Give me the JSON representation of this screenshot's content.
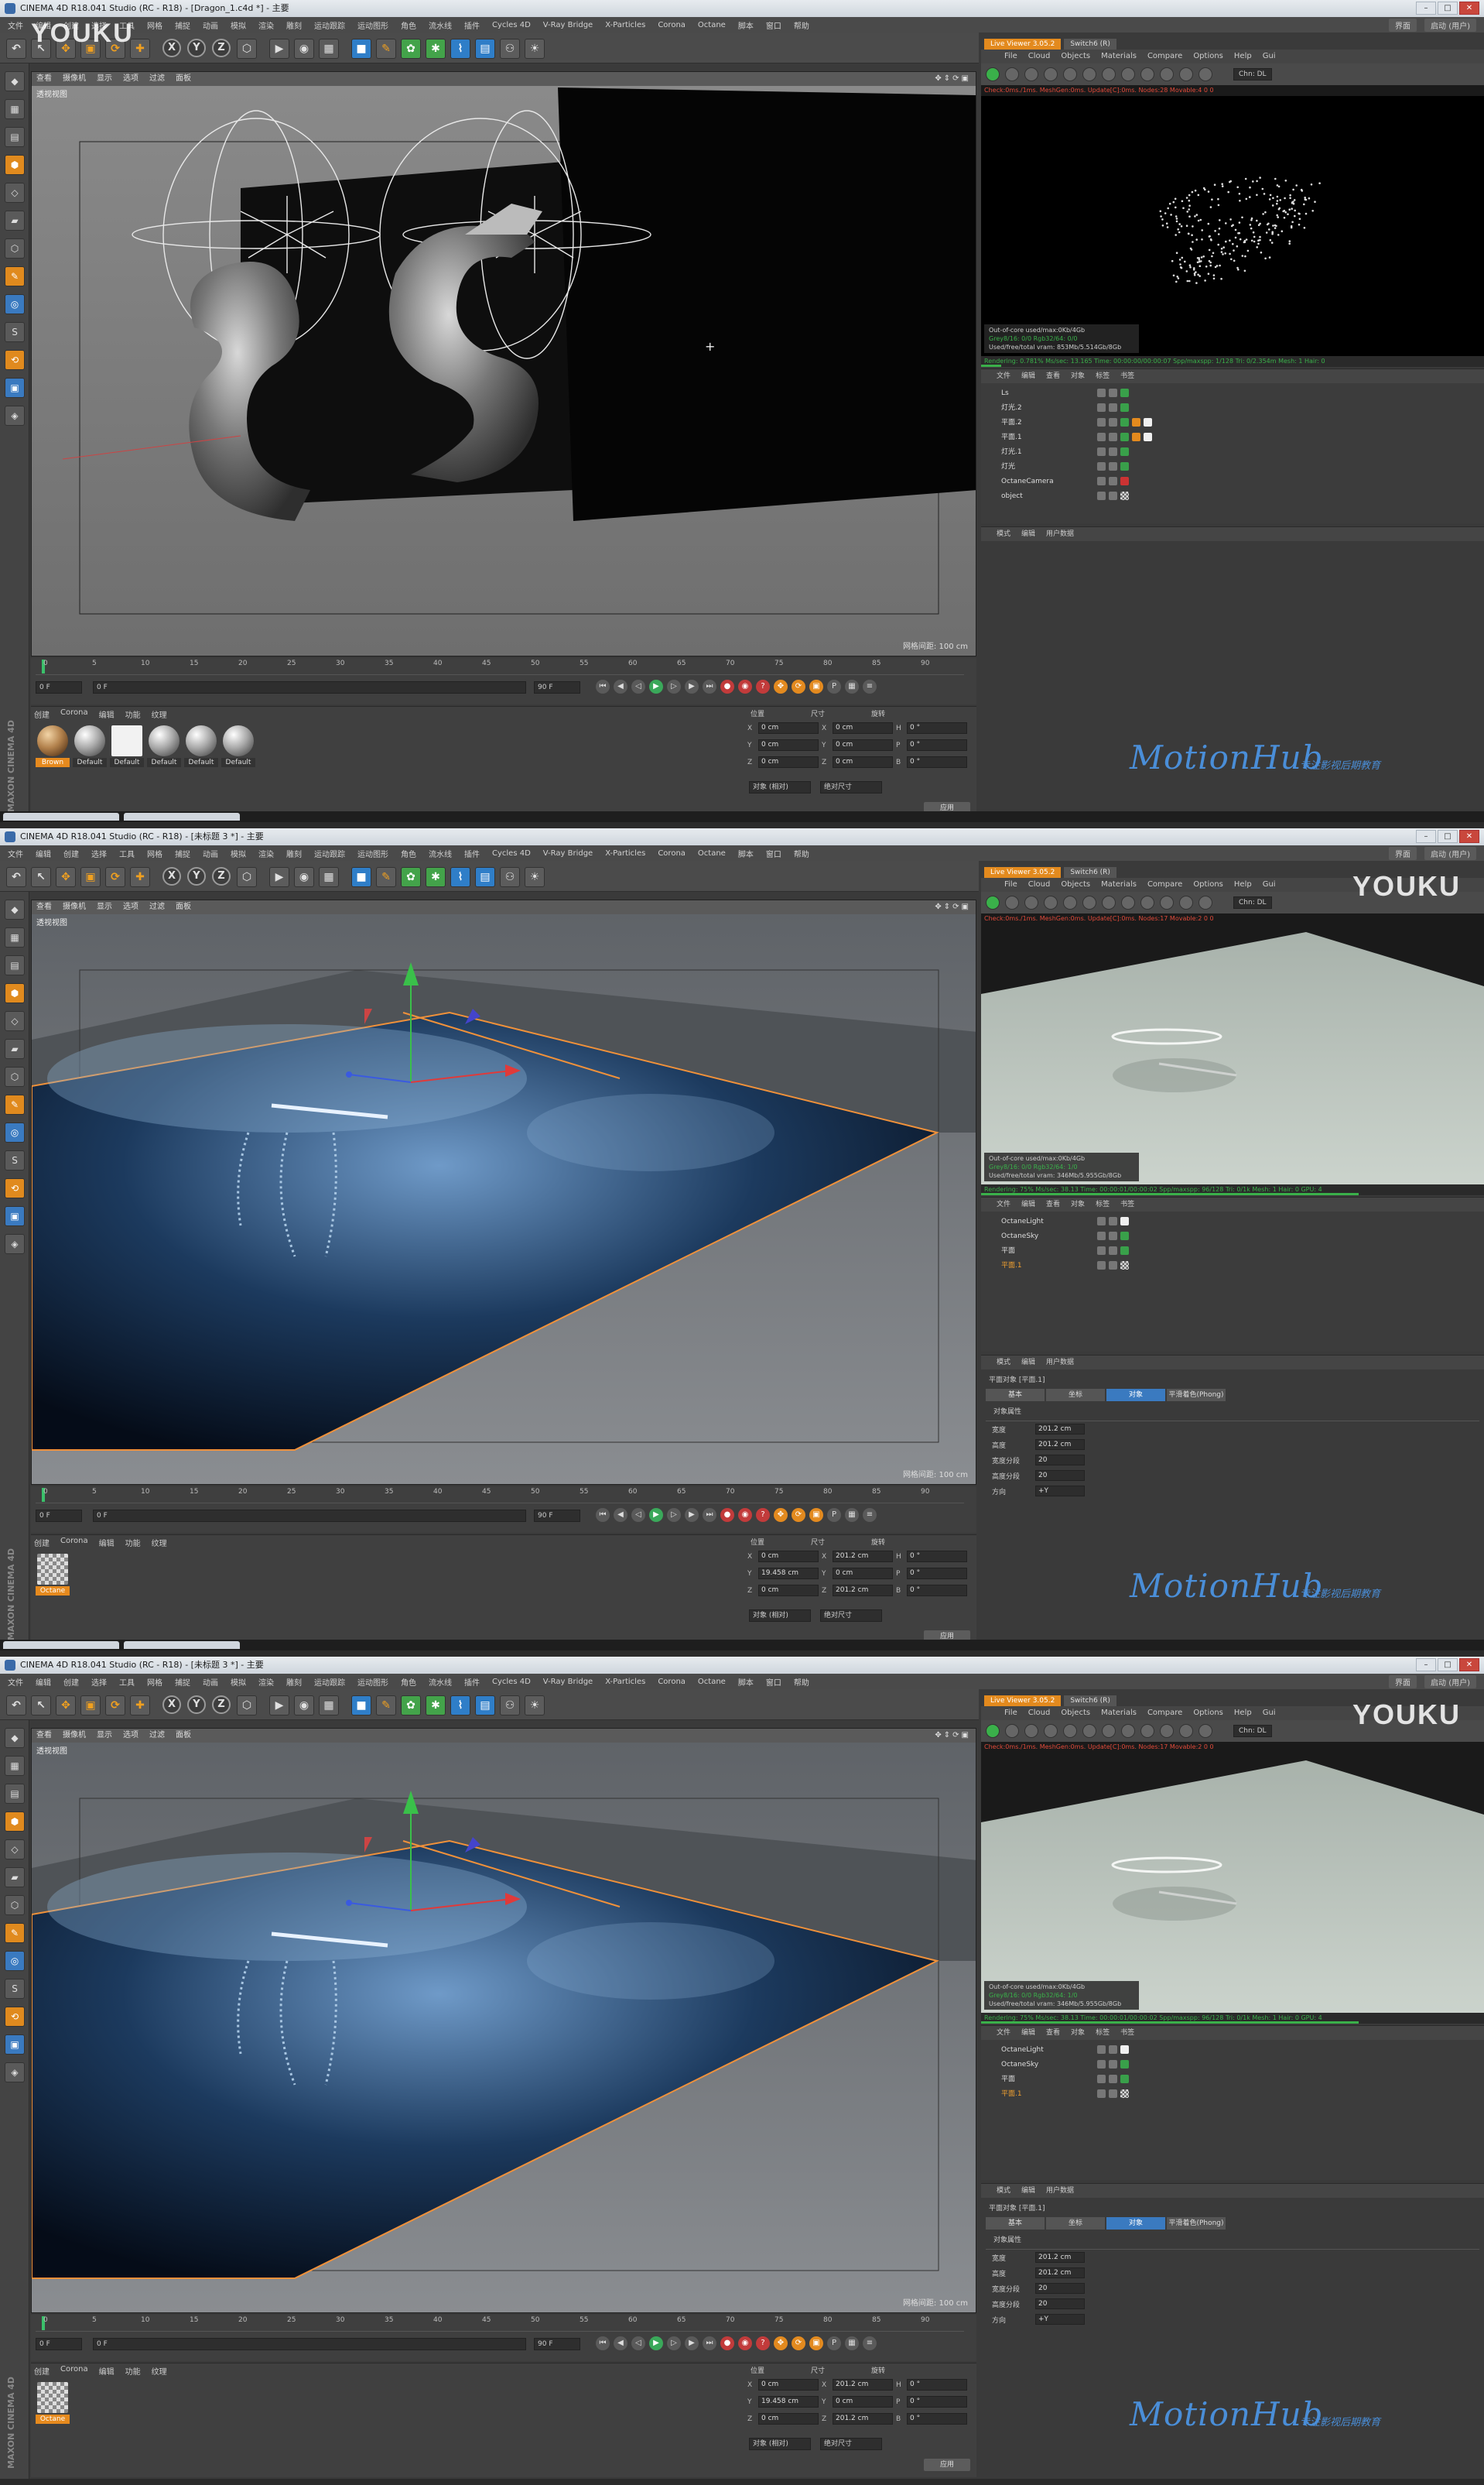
{
  "panels": [
    {
      "title": "CINEMA 4D R18.041 Studio (RC - R18) - [Dragon_1.c4d *] - 主要",
      "scene": "dragon",
      "viewport_label": "透视视图",
      "viewport_scale": "网格间距: 100 cm",
      "render_status": "Check:0ms./1ms. MeshGen:0ms. Update[C]:0ms. Nodes:28 Movable:4 0 0",
      "render_progress": "Rendering: 0.781%  Ms/sec: 13.165  Time: 00:00:00/00:00:07  Spp/maxspp: 1/128  Tri: 0/2.354m  Mesh: 1  Hair: 0",
      "progress": 0.04,
      "live_info": [
        "Out-of-core used/max:0Kb/4Gb",
        "Grey8/16: 0/0     Rgb32/64: 0/0",
        "Used/free/total vram: 853Mb/5.514Gb/8Gb"
      ],
      "objects": [
        {
          "name": "Ls",
          "sel": false,
          "tags": [
            "g"
          ]
        },
        {
          "name": "灯光.2",
          "sel": false,
          "tags": [
            "g"
          ]
        },
        {
          "name": "平面.2",
          "sel": false,
          "tags": [
            "g",
            "o",
            "w"
          ]
        },
        {
          "name": "平面.1",
          "sel": false,
          "tags": [
            "g",
            "o",
            "w"
          ]
        },
        {
          "name": "灯光.1",
          "sel": false,
          "tags": [
            "g"
          ]
        },
        {
          "name": "灯光",
          "sel": false,
          "tags": [
            "g"
          ]
        },
        {
          "name": "OctaneCamera",
          "sel": false,
          "tags": [
            "r"
          ]
        },
        {
          "name": "object",
          "sel": false,
          "tags": [
            "ck"
          ]
        }
      ],
      "materials": [
        {
          "label": "Brown",
          "style": "brown",
          "sel": true
        },
        {
          "label": "Default",
          "style": "",
          "sel": false
        },
        {
          "label": "Default",
          "style": "white",
          "sel": false
        },
        {
          "label": "Default",
          "style": "",
          "sel": false
        },
        {
          "label": "Default",
          "style": "",
          "sel": false
        },
        {
          "label": "Default",
          "style": "",
          "sel": false
        }
      ],
      "coords": [
        [
          "X",
          "0 cm",
          "X",
          "0 cm",
          "H",
          "0 °"
        ],
        [
          "Y",
          "0 cm",
          "Y",
          "0 cm",
          "P",
          "0 °"
        ],
        [
          "Z",
          "0 cm",
          "Z",
          "0 cm",
          "B",
          "0 °"
        ]
      ],
      "attr": null,
      "youku_pos": "topleft"
    },
    {
      "title": "CINEMA 4D R18.041 Studio (RC - R18) - [未标题 3 *] - 主要",
      "scene": "jelly",
      "viewport_label": "透视视图",
      "viewport_scale": "网格间距: 100 cm",
      "render_status": "Check:0ms./1ms. MeshGen:0ms. Update[C]:0ms. Nodes:17 Movable:2 0 0",
      "render_progress": "Rendering: 75%  Ms/sec: 38.13  Time: 00:00:01/00:00:02  Spp/maxspp: 96/128  Tri: 0/1k  Mesh: 1  Hair: 0  GPU: 4",
      "progress": 0.75,
      "live_info": [
        "Out-of-core used/max:0Kb/4Gb",
        "Grey8/16: 0/0     Rgb32/64: 1/0",
        "Used/free/total vram: 346Mb/5.955Gb/8Gb"
      ],
      "objects": [
        {
          "name": "OctaneLight",
          "sel": false,
          "tags": [
            "w"
          ]
        },
        {
          "name": "OctaneSky",
          "sel": false,
          "tags": [
            "g"
          ]
        },
        {
          "name": "平面",
          "sel": false,
          "tags": [
            "g"
          ]
        },
        {
          "name": "平面.1",
          "sel": true,
          "tags": [
            "ck"
          ]
        }
      ],
      "materials": [
        {
          "label": "Octane",
          "style": "chk",
          "sel": true
        }
      ],
      "coords": [
        [
          "X",
          "0 cm",
          "X",
          "201.2 cm",
          "H",
          "0 °"
        ],
        [
          "Y",
          "19.458 cm",
          "Y",
          "0 cm",
          "P",
          "0 °"
        ],
        [
          "Z",
          "0 cm",
          "Z",
          "201.2 cm",
          "B",
          "0 °"
        ]
      ],
      "attr": {
        "object": "平面对象 [平面.1]",
        "tabs": [
          "基本",
          "坐标",
          "对象",
          "平滑着色(Phong)"
        ],
        "active_tab": 2,
        "section": "对象属性",
        "rows": [
          [
            "宽度",
            "201.2 cm"
          ],
          [
            "高度",
            "201.2 cm"
          ],
          [
            "宽度分段",
            "20"
          ],
          [
            "高度分段",
            "20"
          ],
          [
            "方向",
            "+Y"
          ]
        ]
      },
      "youku_pos": "topright"
    },
    {
      "title": "CINEMA 4D R18.041 Studio (RC - R18) - [未标题 3 *] - 主要",
      "scene": "jelly",
      "viewport_label": "透视视图",
      "viewport_scale": "网格间距: 100 cm",
      "render_status": "Check:0ms./1ms. MeshGen:0ms. Update[C]:0ms. Nodes:17 Movable:2 0 0",
      "render_progress": "Rendering: 75%  Ms/sec: 38.13  Time: 00:00:01/00:00:02  Spp/maxspp: 96/128  Tri: 0/1k  Mesh: 1  Hair: 0  GPU: 4",
      "progress": 0.75,
      "live_info": [
        "Out-of-core used/max:0Kb/4Gb",
        "Grey8/16: 0/0     Rgb32/64: 1/0",
        "Used/free/total vram: 346Mb/5.955Gb/8Gb"
      ],
      "objects": [
        {
          "name": "OctaneLight",
          "sel": false,
          "tags": [
            "w"
          ]
        },
        {
          "name": "OctaneSky",
          "sel": false,
          "tags": [
            "g"
          ]
        },
        {
          "name": "平面",
          "sel": false,
          "tags": [
            "g"
          ]
        },
        {
          "name": "平面.1",
          "sel": true,
          "tags": [
            "ck"
          ]
        }
      ],
      "materials": [
        {
          "label": "Octane",
          "style": "chk",
          "sel": true
        }
      ],
      "coords": [
        [
          "X",
          "0 cm",
          "X",
          "201.2 cm",
          "H",
          "0 °"
        ],
        [
          "Y",
          "19.458 cm",
          "Y",
          "0 cm",
          "P",
          "0 °"
        ],
        [
          "Z",
          "0 cm",
          "Z",
          "201.2 cm",
          "B",
          "0 °"
        ]
      ],
      "attr": {
        "object": "平面对象 [平面.1]",
        "tabs": [
          "基本",
          "坐标",
          "对象",
          "平滑着色(Phong)"
        ],
        "active_tab": 2,
        "section": "对象属性",
        "rows": [
          [
            "宽度",
            "201.2 cm"
          ],
          [
            "高度",
            "201.2 cm"
          ],
          [
            "宽度分段",
            "20"
          ],
          [
            "高度分段",
            "20"
          ],
          [
            "方向",
            "+Y"
          ]
        ]
      },
      "youku_pos": "topright"
    }
  ],
  "menu": [
    "文件",
    "编辑",
    "创建",
    "选择",
    "工具",
    "网格",
    "捕捉",
    "动画",
    "模拟",
    "渲染",
    "雕刻",
    "运动跟踪",
    "运动图形",
    "角色",
    "流水线",
    "插件",
    "Cycles 4D",
    "V-Ray Bridge",
    "X-Particles",
    "Corona",
    "Octane",
    "脚本",
    "窗口",
    "帮助"
  ],
  "menu_right": [
    "界面",
    "启动 (用户)"
  ],
  "viewport_menu": [
    "查看",
    "摄像机",
    "显示",
    "选项",
    "过滤",
    "面板"
  ],
  "live_tabs": [
    "Live Viewer 3.05.2",
    "Switch6 (R)"
  ],
  "live_menu": [
    "File",
    "Cloud",
    "Objects",
    "Materials",
    "Compare",
    "Options",
    "Help",
    "Gui"
  ],
  "live_select": "Chn: DL",
  "om_menu": [
    "文件",
    "编辑",
    "查看",
    "对象",
    "标签",
    "书签"
  ],
  "am_menu": [
    "模式",
    "编辑",
    "用户数据"
  ],
  "mat_tabs": [
    "创建",
    "Corona",
    "编辑",
    "功能",
    "纹理"
  ],
  "coord_headers": [
    "位置",
    "尺寸",
    "旋转"
  ],
  "coord_buttons": [
    "对象 (相对)",
    "绝对尺寸",
    "应用"
  ],
  "timeline_ticks": [
    "0",
    "5",
    "10",
    "15",
    "20",
    "25",
    "30",
    "35",
    "40",
    "45",
    "50",
    "55",
    "60",
    "65",
    "70",
    "75",
    "80",
    "85",
    "90"
  ],
  "frame_start": "0 F",
  "frame_end": "90 F",
  "frame_cur": "0 F",
  "brand": {
    "logo": "MotionHub",
    "slogan": "专注影视后期教育",
    "watermark": "YOUKU"
  },
  "maxon": "MAXON CINEMA 4D"
}
